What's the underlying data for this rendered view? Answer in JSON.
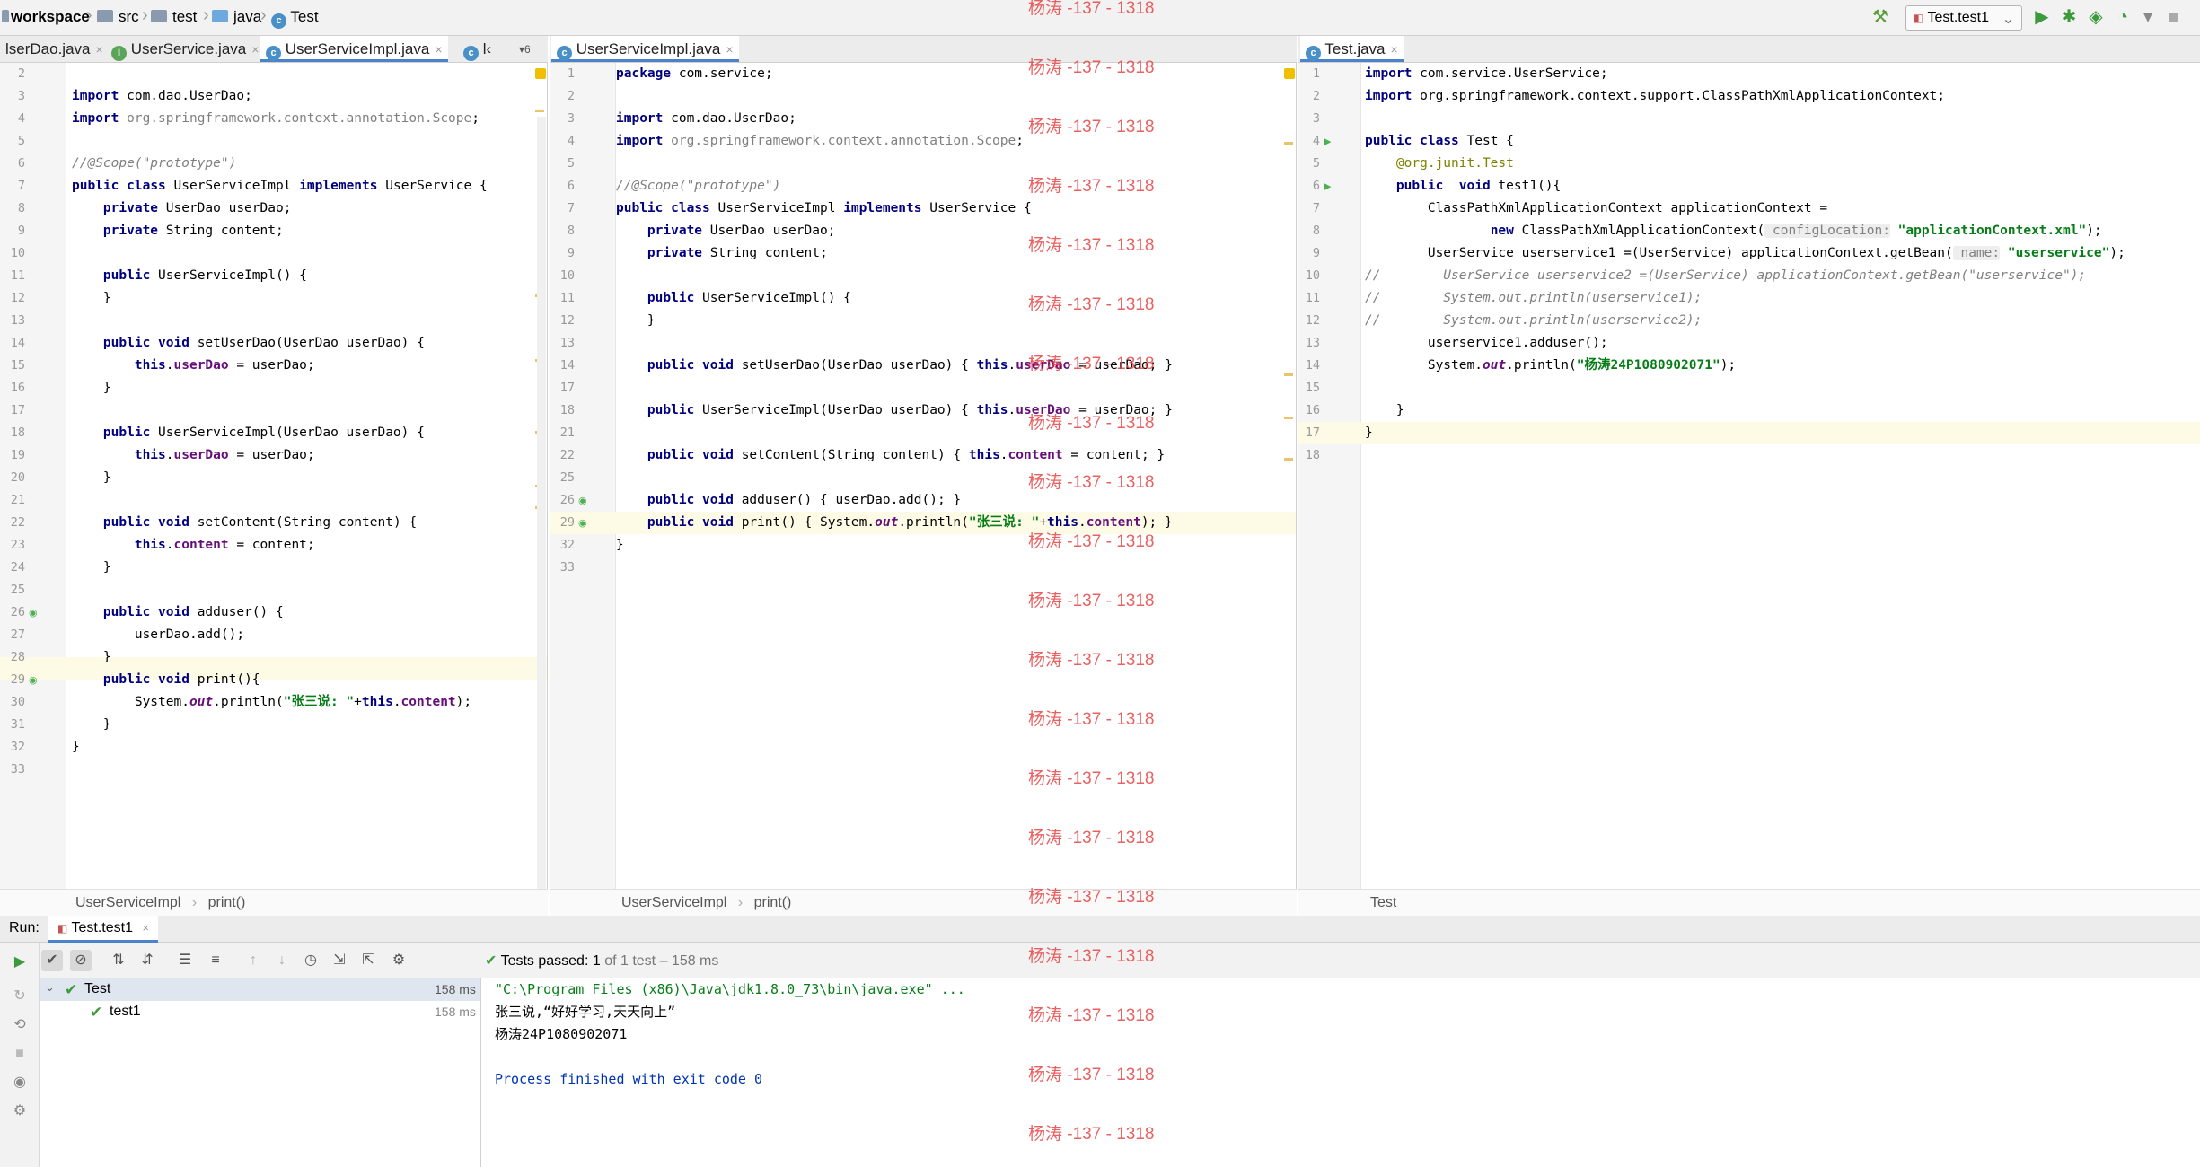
{
  "breadcrumb": [
    "workspace",
    "src",
    "test",
    "java",
    "Test"
  ],
  "run_config": "Test.test1",
  "watermark": "杨涛 -137 - 1318",
  "pane1": {
    "tabs": [
      "lserDao.java",
      "UserService.java",
      "UserServiceImpl.java",
      "l‹"
    ],
    "tab_overflow": "▾6",
    "status": [
      "UserServiceImpl",
      "print()"
    ],
    "lines": [
      {
        "n": "2",
        "c": ""
      },
      {
        "n": "3",
        "c": "import com.dao.UserDao;"
      },
      {
        "n": "4",
        "c": "import org.springframework.context.annotation.Scope;"
      },
      {
        "n": "5",
        "c": ""
      },
      {
        "n": "6",
        "c": "//@Scope(\"prototype\")"
      },
      {
        "n": "7",
        "c": "public class UserServiceImpl implements UserService {"
      },
      {
        "n": "8",
        "c": "    private UserDao userDao;"
      },
      {
        "n": "9",
        "c": "    private String content;"
      },
      {
        "n": "10",
        "c": ""
      },
      {
        "n": "11",
        "c": "    public UserServiceImpl() {"
      },
      {
        "n": "12",
        "c": "    }"
      },
      {
        "n": "13",
        "c": ""
      },
      {
        "n": "14",
        "c": "    public void setUserDao(UserDao userDao) {"
      },
      {
        "n": "15",
        "c": "        this.userDao = userDao;"
      },
      {
        "n": "16",
        "c": "    }"
      },
      {
        "n": "17",
        "c": ""
      },
      {
        "n": "18",
        "c": "    public UserServiceImpl(UserDao userDao) {"
      },
      {
        "n": "19",
        "c": "        this.userDao = userDao;"
      },
      {
        "n": "20",
        "c": "    }"
      },
      {
        "n": "21",
        "c": ""
      },
      {
        "n": "22",
        "c": "    public void setContent(String content) {"
      },
      {
        "n": "23",
        "c": "        this.content = content;"
      },
      {
        "n": "24",
        "c": "    }"
      },
      {
        "n": "25",
        "c": ""
      },
      {
        "n": "26",
        "c": "    public void adduser() {"
      },
      {
        "n": "27",
        "c": "        userDao.add();"
      },
      {
        "n": "28",
        "c": "    }"
      },
      {
        "n": "29",
        "c": "    public void print(){"
      },
      {
        "n": "30",
        "c": "        System.out.println(\"张三说: \"+this.content);"
      },
      {
        "n": "31",
        "c": "    }"
      },
      {
        "n": "32",
        "c": "}"
      },
      {
        "n": "33",
        "c": ""
      }
    ]
  },
  "pane2": {
    "tabs": [
      "UserServiceImpl.java"
    ],
    "status": [
      "UserServiceImpl",
      "print()"
    ],
    "lines": [
      {
        "n": "1",
        "c": "package com.service;"
      },
      {
        "n": "2",
        "c": ""
      },
      {
        "n": "3",
        "c": "import com.dao.UserDao;"
      },
      {
        "n": "4",
        "c": "import org.springframework.context.annotation.Scope;"
      },
      {
        "n": "5",
        "c": ""
      },
      {
        "n": "6",
        "c": "//@Scope(\"prototype\")"
      },
      {
        "n": "7",
        "c": "public class UserServiceImpl implements UserService {"
      },
      {
        "n": "8",
        "c": "    private UserDao userDao;"
      },
      {
        "n": "9",
        "c": "    private String content;"
      },
      {
        "n": "10",
        "c": ""
      },
      {
        "n": "11",
        "c": "    public UserServiceImpl() {"
      },
      {
        "n": "12",
        "c": "    }"
      },
      {
        "n": "13",
        "c": ""
      },
      {
        "n": "14",
        "c": "    public void setUserDao(UserDao userDao) { this.userDao = userDao; }"
      },
      {
        "n": "17",
        "c": ""
      },
      {
        "n": "18",
        "c": "    public UserServiceImpl(UserDao userDao) { this.userDao = userDao; }"
      },
      {
        "n": "21",
        "c": ""
      },
      {
        "n": "22",
        "c": "    public void setContent(String content) { this.content = content; }"
      },
      {
        "n": "25",
        "c": ""
      },
      {
        "n": "26",
        "c": "    public void adduser() { userDao.add(); }"
      },
      {
        "n": "29",
        "c": "    public void print() { System.out.println(\"张三说: \"+this.content); }"
      },
      {
        "n": "32",
        "c": "}"
      },
      {
        "n": "33",
        "c": ""
      }
    ]
  },
  "pane3": {
    "tabs": [
      "Test.java"
    ],
    "status": [
      "Test"
    ],
    "lines": [
      {
        "n": "1",
        "c": "import com.service.UserService;"
      },
      {
        "n": "2",
        "c": "import org.springframework.context.support.ClassPathXmlApplicationContext;"
      },
      {
        "n": "3",
        "c": ""
      },
      {
        "n": "4",
        "c": "public class Test {"
      },
      {
        "n": "5",
        "c": "    @org.junit.Test"
      },
      {
        "n": "6",
        "c": "    public  void test1(){"
      },
      {
        "n": "7",
        "c": "        ClassPathXmlApplicationContext applicationContext ="
      },
      {
        "n": "8",
        "c": "                new ClassPathXmlApplicationContext( configLocation: \"applicationContext.xml\");"
      },
      {
        "n": "9",
        "c": "        UserService userservice1 =(UserService) applicationContext.getBean( name: \"userservice\");"
      },
      {
        "n": "10",
        "c": "//        UserService userservice2 =(UserService) applicationContext.getBean(\"userservice\");"
      },
      {
        "n": "11",
        "c": "//        System.out.println(userservice1);"
      },
      {
        "n": "12",
        "c": "//        System.out.println(userservice2);"
      },
      {
        "n": "13",
        "c": "        userservice1.adduser();"
      },
      {
        "n": "14",
        "c": "        System.out.println(\"杨涛24P1080902071\");"
      },
      {
        "n": "15",
        "c": ""
      },
      {
        "n": "16",
        "c": "    }"
      },
      {
        "n": "17",
        "c": "}"
      },
      {
        "n": "18",
        "c": ""
      }
    ]
  },
  "run": {
    "label": "Run:",
    "tab": "Test.test1",
    "status_prefix": "Tests passed:",
    "status_count": "1",
    "status_suffix": "of 1 test – 158 ms",
    "tree": [
      {
        "name": "Test",
        "time": "158 ms"
      },
      {
        "name": "test1",
        "time": "158 ms"
      }
    ],
    "console": [
      "\"C:\\Program Files (x86)\\Java\\jdk1.8.0_73\\bin\\java.exe\" ...",
      "张三说,“好好学习,天天向上”",
      "杨涛24P1080902071",
      "",
      "Process finished with exit code 0"
    ]
  }
}
